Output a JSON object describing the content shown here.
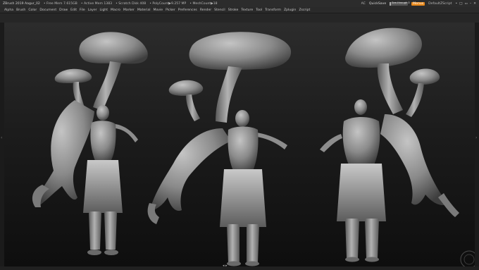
{
  "titlebar": {
    "app_title": "ZBrush 2019   Aagur_02",
    "free_mem": "• Free Mem 7.615GB",
    "active_mem": "• Active Mem 1383",
    "scratch_disk": "• Scratch Disk 408",
    "poly_count": "• PolyCount▶9.257 MP",
    "mesh_count": "• MeshCount▶18",
    "ac_label": "AC",
    "quicksave": "QuickSave",
    "see_through": "See-through 0",
    "menus": "Menus",
    "script": "DefaultZScript",
    "window_controls": [
      "•",
      "□",
      "▭",
      "–",
      "✕"
    ]
  },
  "menubar": {
    "items": [
      "Alpha",
      "Brush",
      "Color",
      "Document",
      "Draw",
      "Edit",
      "File",
      "Layer",
      "Light",
      "Macro",
      "Marker",
      "Material",
      "Movie",
      "Picker",
      "Preferences",
      "Render",
      "Stencil",
      "Stroke",
      "Texture",
      "Tool",
      "Transform",
      "Zplugin",
      "Zscript"
    ]
  },
  "viewport": {
    "colors": {
      "clay": "#8f8f8f",
      "clay_light": "#b8b8b8",
      "clay_dark": "#4a4a4a",
      "bg_top": "#2c2c2c",
      "bg_bottom": "#0e0e0e"
    }
  },
  "icons": {
    "left_arrow": "‹",
    "right_arrow": "›",
    "nav_arrows": "◂ ▸"
  }
}
